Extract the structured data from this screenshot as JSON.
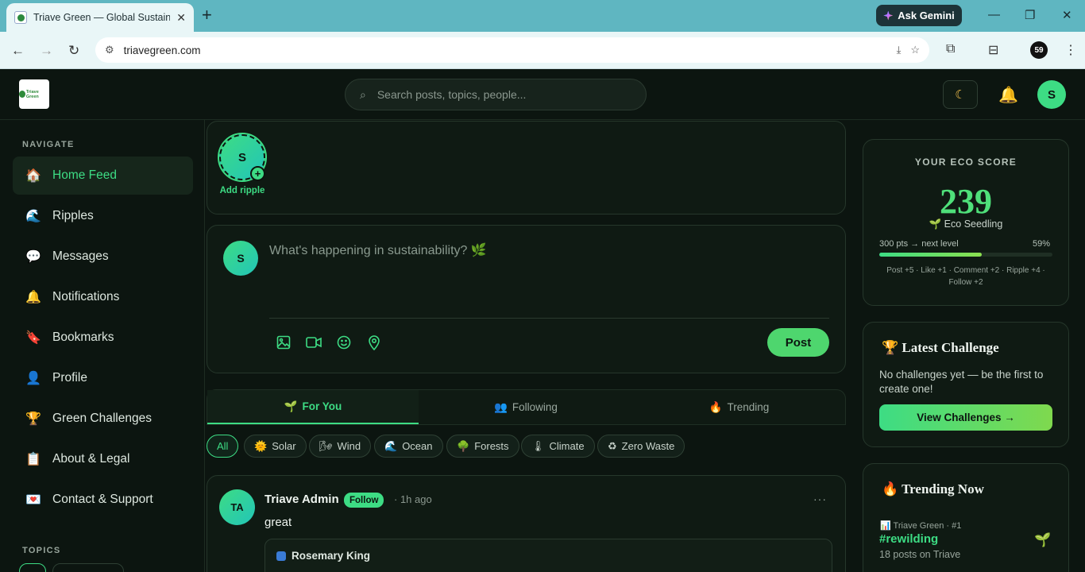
{
  "browser": {
    "tab_title": "Triave Green — Global Sustaina",
    "tab_close": "✕",
    "new_tab": "+",
    "gemini_label": "Ask Gemini",
    "url": "triavegreen.com",
    "profile_badge": "59"
  },
  "header": {
    "logo_text": "Triave Green",
    "search_placeholder": "Search posts, topics, people...",
    "avatar_initial": "S"
  },
  "sidebar": {
    "navigate_label": "NAVIGATE",
    "topics_label": "TOPICS",
    "items": [
      {
        "label": "Home Feed",
        "icon": "🏠",
        "active": true
      },
      {
        "label": "Ripples",
        "icon": "🌊"
      },
      {
        "label": "Messages",
        "icon": "💬"
      },
      {
        "label": "Notifications",
        "icon": "🔔"
      },
      {
        "label": "Bookmarks",
        "icon": "🔖"
      },
      {
        "label": "Profile",
        "icon": "👤"
      },
      {
        "label": "Green Challenges",
        "icon": "🏆"
      },
      {
        "label": "About & Legal",
        "icon": "📋"
      },
      {
        "label": "Contact & Support",
        "icon": "💌"
      }
    ]
  },
  "ripples": {
    "avatar_initial": "S",
    "add_label": "Add ripple"
  },
  "composer": {
    "avatar_initial": "S",
    "placeholder": "What's happening in sustainability? 🌿",
    "post_label": "Post"
  },
  "feed_tabs": [
    {
      "label": "For You",
      "icon": "🌱",
      "active": true
    },
    {
      "label": "Following",
      "icon": "👥"
    },
    {
      "label": "Trending",
      "icon": "🔥"
    }
  ],
  "chips": [
    {
      "label": "All",
      "icon": "",
      "active": true
    },
    {
      "label": "Solar",
      "icon": "🌞"
    },
    {
      "label": "Wind",
      "icon": "🌬"
    },
    {
      "label": "Ocean",
      "icon": "🌊"
    },
    {
      "label": "Forests",
      "icon": "🌳"
    },
    {
      "label": "Climate",
      "icon": "🌡"
    },
    {
      "label": "Zero Waste",
      "icon": "♻"
    }
  ],
  "post": {
    "avatar_initials": "TA",
    "author": "Triave Admin",
    "follow_label": "Follow",
    "time": "· 1h ago",
    "more": "···",
    "text": "great",
    "quote_author": "Rosemary King"
  },
  "eco_score": {
    "header": "YOUR ECO SCORE",
    "score": "239",
    "level": "🌱 Eco Seedling",
    "next_level": "300 pts → next level",
    "percent_label": "59%",
    "progress": 0.59,
    "rules": "Post +5 · Like +1 · Comment +2 · Ripple +4 · Follow +2"
  },
  "challenge": {
    "title": "🏆 Latest Challenge",
    "description": "No challenges yet — be the first to create one!",
    "button": "View Challenges →"
  },
  "trending": {
    "title": "🔥 Trending Now",
    "source": "📊 Triave Green · #1",
    "tag": "#rewilding",
    "count": "18 posts on Triave",
    "icon": "🌱"
  }
}
